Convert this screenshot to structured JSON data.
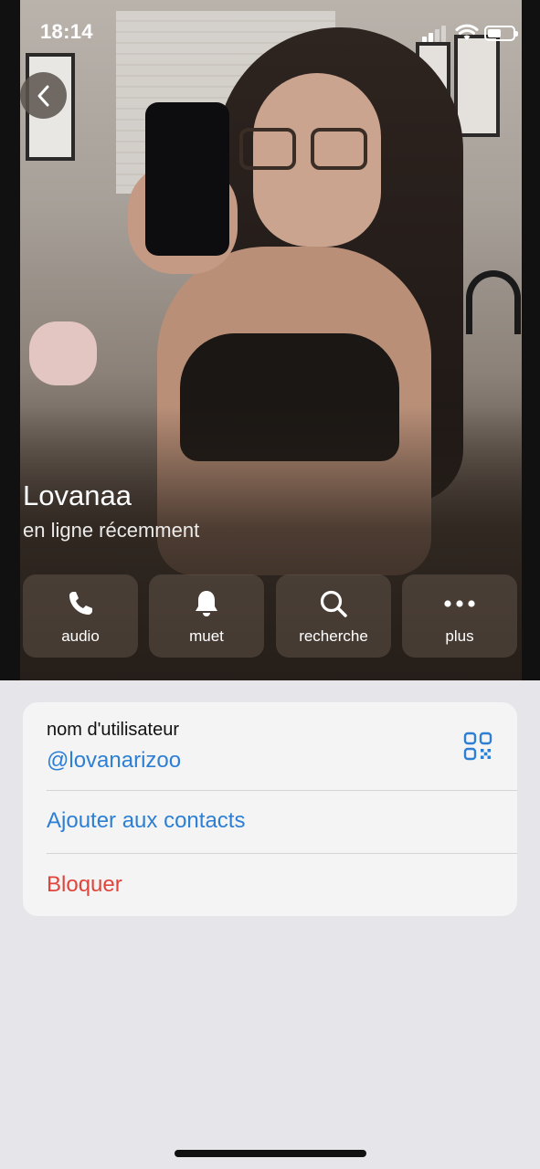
{
  "status_bar": {
    "time": "18:14",
    "battery_level": 0.55,
    "signal_bars": 2,
    "signal_total": 4
  },
  "back": {
    "icon": "chevron-left-icon"
  },
  "profile": {
    "name": "Lovanaa",
    "status": "en ligne récemment"
  },
  "actions": [
    {
      "id": "audio",
      "label": "audio",
      "icon": "phone-icon"
    },
    {
      "id": "mute",
      "label": "muet",
      "icon": "bell-icon"
    },
    {
      "id": "search",
      "label": "recherche",
      "icon": "search-icon"
    },
    {
      "id": "more",
      "label": "plus",
      "icon": "ellipsis-icon"
    }
  ],
  "info": {
    "username_label": "nom d'utilisateur",
    "username_value": "@lovanarizoo",
    "add_contact": "Ajouter aux contacts",
    "block": "Bloquer"
  },
  "colors": {
    "link": "#2d7fd4",
    "destructive": "#e0443b",
    "background": "#e5e5ea"
  }
}
